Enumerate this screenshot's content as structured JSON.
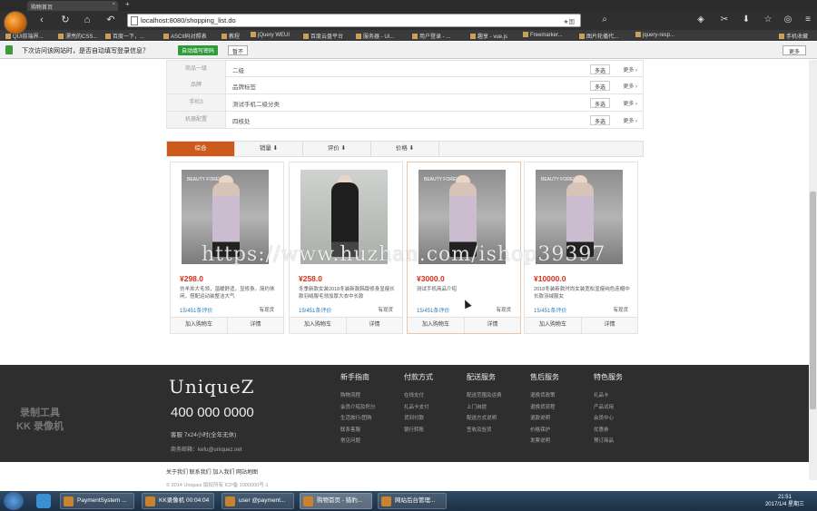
{
  "browser": {
    "tab_title": "购物首页",
    "url": "localhost:8080/shopping_list.do",
    "url_right": "★国",
    "bookmarks": [
      "QUI前端界...",
      "漂亮的CSS...",
      "百度一下，...",
      "ASCII码对照表",
      "教程",
      "jQuery WEUI",
      "百度云盘平台",
      "服务器 - UI...",
      "用户登录 - ...",
      "趣享 - vue.js",
      "Freemarker...",
      "图片轮播代...",
      "jquery-resp...",
      "手机收藏"
    ],
    "password_prompt": "下次访问该网站时，是否自动填写登录信息？",
    "password_yes": "自动填写密码",
    "password_no": "暂不",
    "password_more": "更多"
  },
  "filters": [
    {
      "label": "商品一级",
      "value": "二级",
      "multi": "多选",
      "more": "更多"
    },
    {
      "label": "品牌",
      "value": "品牌标签",
      "multi": "多选",
      "more": "更多"
    },
    {
      "label": "手机3",
      "value": "测试手机二级分类",
      "multi": "多选",
      "more": "更多"
    },
    {
      "label": "机器配置",
      "value": "四核处",
      "multi": "多选",
      "more": "更多"
    }
  ],
  "sort_tabs": [
    "综合",
    "销量 ⬇",
    "评价 ⬇",
    "价格 ⬇"
  ],
  "products": [
    {
      "price": "¥298.0",
      "desc": "仿羊羔大毛领，温暖舒适，显修身。简约休闲，搭配运动装整洁大气",
      "reviews": "15/451条评价",
      "ship": "有现货",
      "cart": "加入购物车",
      "detail": "详情",
      "img_text": "BEAUTY FOREVER"
    },
    {
      "price": "¥258.0",
      "desc": "冬季新款女装2018冬装新款韩版修身显瘦长款羽绒服毛领加厚大衣中长款",
      "reviews": "15/451条评价",
      "ship": "有现货",
      "cart": "加入购物车",
      "detail": "详情",
      "img_text": ""
    },
    {
      "price": "¥3000.0",
      "desc": "测试手机商品介绍",
      "reviews": "15/451条评价",
      "ship": "有现货",
      "cart": "加入购物车",
      "detail": "详情",
      "img_text": "BEAUTY FOREVER"
    },
    {
      "price": "¥10000.0",
      "desc": "2018冬装新款时尚女装宽松显瘦纯色连帽中长款羽绒服女",
      "reviews": "15/451条评价",
      "ship": "有现货",
      "cart": "加入购物车",
      "detail": "详情",
      "img_text": "BEAUTY FOREVER"
    }
  ],
  "watermark": "https://www.huzhan.com/ishop39397",
  "footer": {
    "brand": "UniqueZ",
    "phone": "400 000 0000",
    "hours": "客服 7x24小时(全年无休)",
    "mail": "商务邮箱：kefu@uniquez.net",
    "recorder": "录制工具\nKK 录像机",
    "columns": [
      {
        "title": "新手指南",
        "items": [
          "购物流程",
          "会员介绍及积分",
          "生活旅行/团购",
          "联系客服",
          "常见问题"
        ]
      },
      {
        "title": "付款方式",
        "items": [
          "在线支付",
          "礼品卡支付",
          "货到付款",
          "银行转账"
        ]
      },
      {
        "title": "配送服务",
        "items": [
          "配送范围及运费",
          "上门自提",
          "配送方式说明",
          "签收及验货"
        ]
      },
      {
        "title": "售后服务",
        "items": [
          "退换货政策",
          "退换货流程",
          "退款说明",
          "价格保护",
          "发票说明"
        ]
      },
      {
        "title": "特色服务",
        "items": [
          "礼品卡",
          "产品试用",
          "会员中心",
          "优惠券",
          "预订商品"
        ]
      }
    ],
    "links": "关于我们  联系我们  加入我们  网站地图",
    "copyright": "© 2014 Uniquez 版权所有 ICP备 1000000号-1"
  },
  "taskbar": {
    "tasks": [
      "PaymentSystem ...",
      "KK录像机 00:04:04",
      "user @payment...",
      "购物首页 - 猎豹...",
      "网站后台管理..."
    ],
    "time": "21:51",
    "date": "2017/1/4 星期三"
  }
}
